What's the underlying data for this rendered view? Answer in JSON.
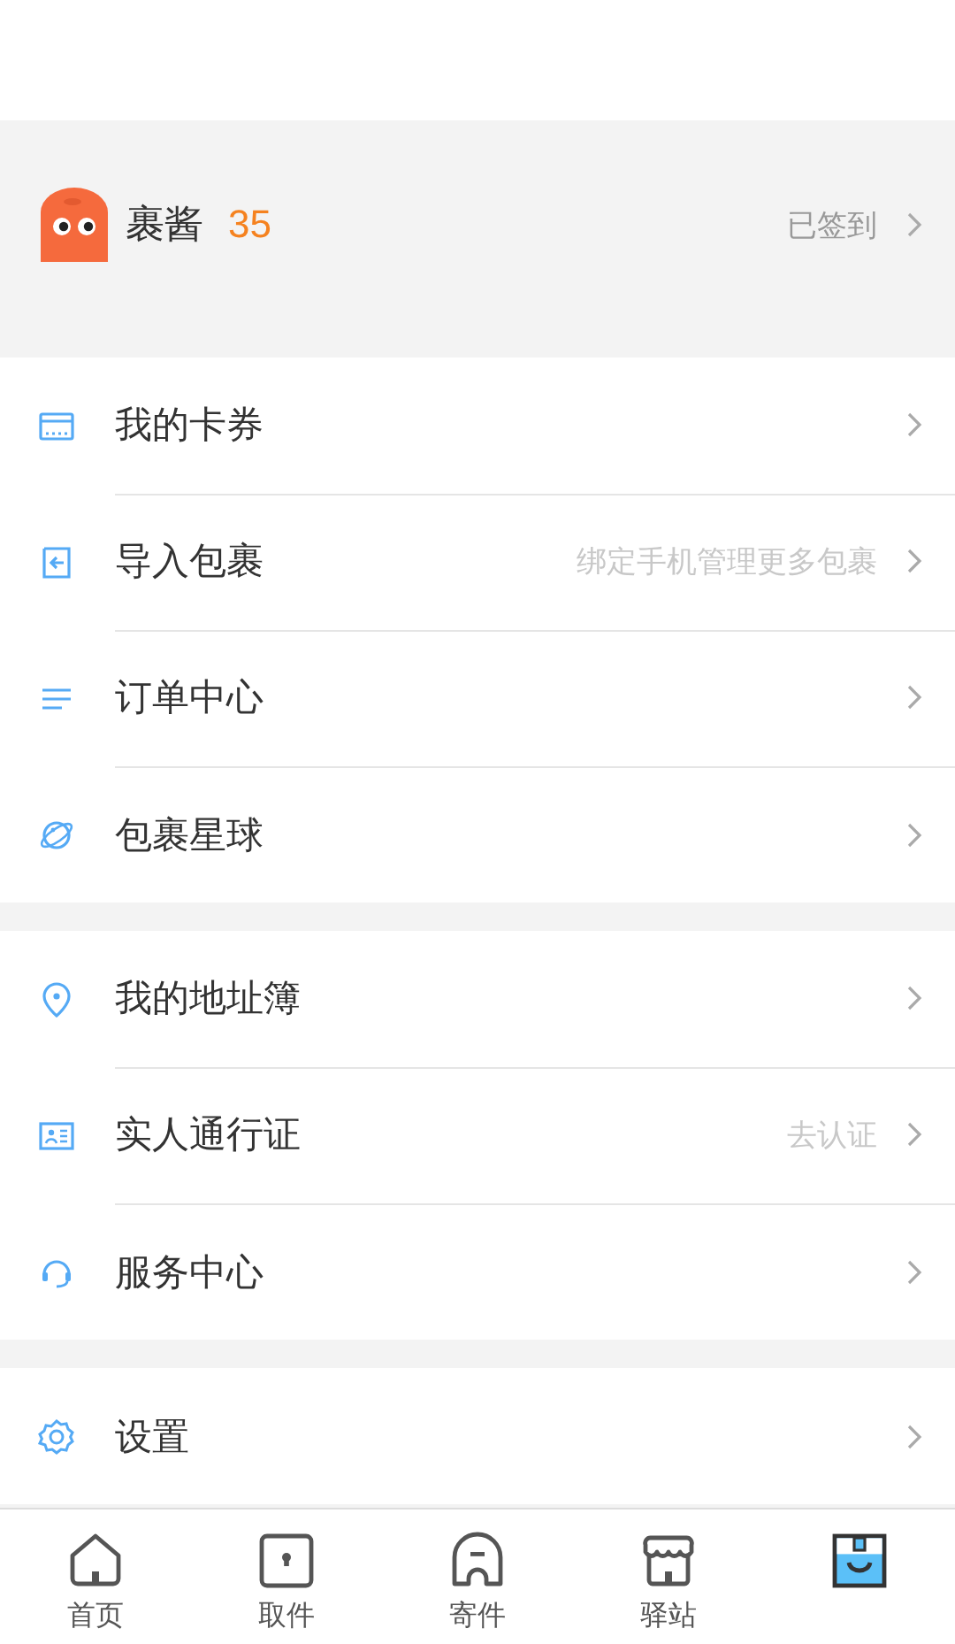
{
  "profile": {
    "name": "裹酱",
    "points": "35",
    "checkin": "已签到"
  },
  "groups": [
    [
      {
        "label": "我的卡券"
      },
      {
        "label": "导入包裹",
        "hint": "绑定手机管理更多包裹"
      },
      {
        "label": "订单中心"
      },
      {
        "label": "包裹星球"
      }
    ],
    [
      {
        "label": "我的地址簿"
      },
      {
        "label": "实人通行证",
        "hint": "去认证"
      },
      {
        "label": "服务中心"
      }
    ],
    [
      {
        "label": "设置"
      }
    ]
  ],
  "tabs": [
    {
      "label": "首页",
      "selected": false
    },
    {
      "label": "取件",
      "selected": false
    },
    {
      "label": "寄件",
      "selected": false
    },
    {
      "label": "驿站",
      "selected": false
    },
    {
      "selected": true
    }
  ]
}
